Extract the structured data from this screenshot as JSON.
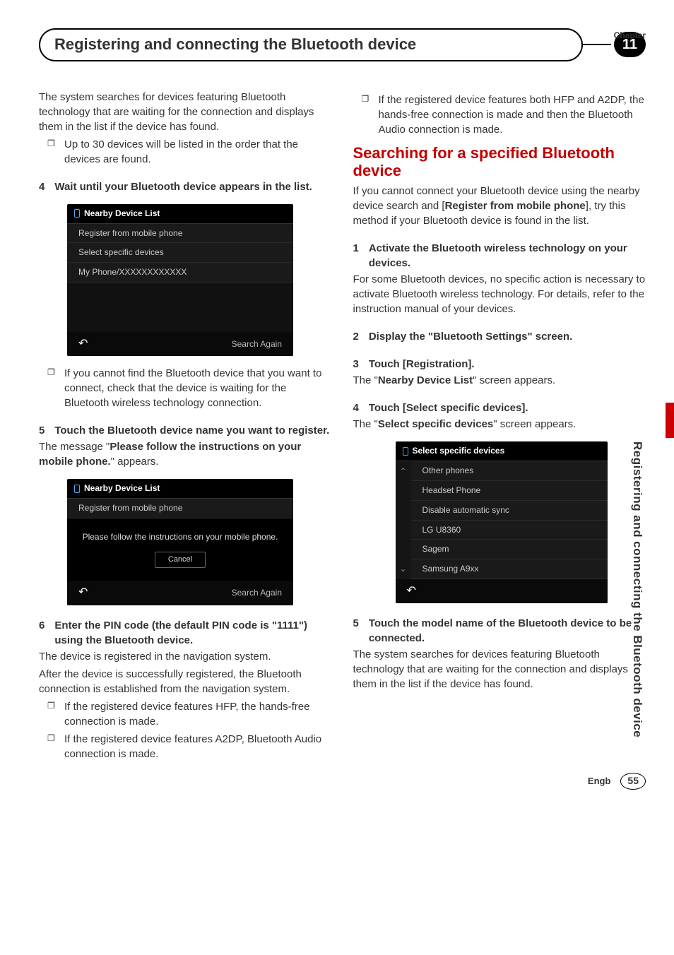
{
  "chapter_label": "Chapter",
  "chapter_number": "11",
  "header": "Registering and connecting the Bluetooth device",
  "side_text": "Registering and connecting the Bluetooth device",
  "footer": {
    "lang": "Engb",
    "page": "55"
  },
  "left": {
    "intro": "The system searches for devices featuring Bluetooth technology that are waiting for the connection and displays them in the list if the device has found.",
    "intro_bullet": "Up to 30 devices will be listed in the order that the devices are found.",
    "step4": {
      "num": "4",
      "text": "Wait until your Bluetooth device appears in the list."
    },
    "ss1": {
      "title": "Nearby Device List",
      "rows": [
        "Register from mobile phone",
        "Select specific devices",
        "My Phone/XXXXXXXXXXXX"
      ],
      "back": "↶",
      "search": "Search Again"
    },
    "step4_bullet": "If you cannot find the Bluetooth device that you want to connect, check that the device is waiting for the Bluetooth wireless technology connection.",
    "step5": {
      "num": "5",
      "text": "Touch the Bluetooth device name you want to register."
    },
    "step5_msg_a": "The message \"",
    "step5_msg_bold": "Please follow the instructions on your mobile phone.",
    "step5_msg_b": "\" appears.",
    "ss2": {
      "title": "Nearby Device List",
      "row": "Register from mobile phone",
      "dialog": "Please follow the instructions on your mobile phone.",
      "cancel": "Cancel",
      "back": "↶",
      "search": "Search Again"
    },
    "step6": {
      "num": "6",
      "text": "Enter the PIN code (the default PIN code is \"1111\") using the Bluetooth device."
    },
    "step6_p1": "The device is registered in the navigation system.",
    "step6_p2": "After the device is successfully registered, the Bluetooth connection is established from the navigation system.",
    "step6_bullets": [
      "If the registered device features HFP, the hands-free connection is made.",
      "If the registered device features A2DP, Bluetooth Audio connection is made."
    ]
  },
  "right": {
    "top_bullet": "If the registered device features both HFP and A2DP, the hands-free connection is made and then the Bluetooth Audio connection is made.",
    "section_title": "Searching for a specified Bluetooth device",
    "sec_intro_a": "If you cannot connect your Bluetooth device using the nearby device search and [",
    "sec_intro_bold": "Register from mobile phone",
    "sec_intro_b": "], try this method if your Bluetooth device is found in the list.",
    "step1": {
      "num": "1",
      "text": "Activate the Bluetooth wireless technology on your devices."
    },
    "step1_p": "For some Bluetooth devices, no specific action is necessary to activate Bluetooth wireless technology. For details, refer to the instruction manual of your devices.",
    "step2": {
      "num": "2",
      "text": "Display the \"Bluetooth Settings\" screen."
    },
    "step3": {
      "num": "3",
      "text": "Touch [Registration]."
    },
    "step3_p_a": "The \"",
    "step3_p_bold": "Nearby Device List",
    "step3_p_b": "\" screen appears.",
    "step4": {
      "num": "4",
      "text": "Touch [Select specific devices]."
    },
    "step4_p_a": "The \"",
    "step4_p_bold": "Select specific devices",
    "step4_p_b": "\" screen appears.",
    "ss3": {
      "title": "Select specific devices",
      "rows": [
        "Other phones",
        "Headset Phone",
        "Disable automatic sync",
        "LG U8360",
        "Sagem",
        "Samsung A9xx"
      ],
      "up": "⌃",
      "down": "⌄",
      "back": "↶"
    },
    "step5": {
      "num": "5",
      "text": "Touch the model name of the Bluetooth device to be connected."
    },
    "step5_p": "The system searches for devices featuring Bluetooth technology that are waiting for the connection and displays them in the list if the device has found."
  }
}
